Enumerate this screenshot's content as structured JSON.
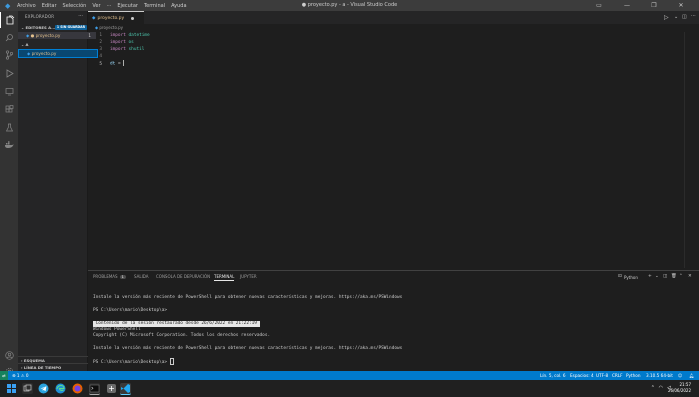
{
  "titlebar": {
    "menu": [
      "Archivo",
      "Editar",
      "Selección",
      "Ver",
      "···",
      "Ejecutar",
      "Terminal",
      "Ayuda"
    ],
    "title": "● proyecto.py - a - Visual Studio Code",
    "controls": [
      "—",
      "❐",
      "✕"
    ]
  },
  "sidebar": {
    "title": "EXPLORADOR",
    "open_editors_label": "EDITORES A...",
    "unsaved_badge": "1 SIN GUARDAR",
    "open_editor_file": "● proyecto.py",
    "open_editor_count": "1",
    "folder_label": "A",
    "folder_file": "proyecto.py",
    "outline_label": "ESQUEMA",
    "timeline_label": "LÍNEA DE TIEMPO"
  },
  "editor": {
    "tab_label": "proyecto.py",
    "breadcrumb": "proyecto.py",
    "lines": [
      {
        "n": "1",
        "kw": "import",
        "name": "datetime"
      },
      {
        "n": "2",
        "kw": "import",
        "name": "os"
      },
      {
        "n": "3",
        "kw": "import",
        "name": "shutil"
      },
      {
        "n": "4"
      },
      {
        "n": "5",
        "var": "dt",
        "op": " = "
      }
    ]
  },
  "panel": {
    "tabs": [
      "PROBLEMAS",
      "SALIDA",
      "CONSOLA DE DEPURACIÓN",
      "TERMINAL",
      "JUPYTER"
    ],
    "problems_count": "1",
    "active_tab": "TERMINAL",
    "shell_label": "Python",
    "terminal_lines": [
      "Instale la versión más reciente de PowerShell para obtener nuevas características y mejoras. https://aka.ms/PSWindows",
      "",
      "PS C:\\Users\\mario\\Desktop\\a>",
      "",
      " Contenido de la sesión restaurado desde 26/6/2022 en 21:22:19 ",
      "Windows PowerShell",
      "Copyright (C) Microsoft Corporation. Todos los derechos reservados.",
      "",
      "Instale la versión más reciente de PowerShell para obtener nuevas características y mejoras. https://aka.ms/PSWindows",
      "",
      "PS C:\\Users\\mario\\Desktop\\a> "
    ]
  },
  "statusbar": {
    "errors": "⊗ 1 ⚠ 0",
    "position": "Lín. 5, col. 6",
    "spaces": "Espacios: 4",
    "encoding": "UTF-8",
    "eol": "CRLF",
    "language": "Python",
    "interpreter": "3.10.5 64-bit"
  },
  "taskbar": {
    "time": "21:57",
    "date": "26/06/2022"
  },
  "colors": {
    "accent": "#007acc",
    "editor_bg": "#1e1e1e",
    "sidebar_bg": "#252526",
    "taskbar_bg": "#202020"
  }
}
